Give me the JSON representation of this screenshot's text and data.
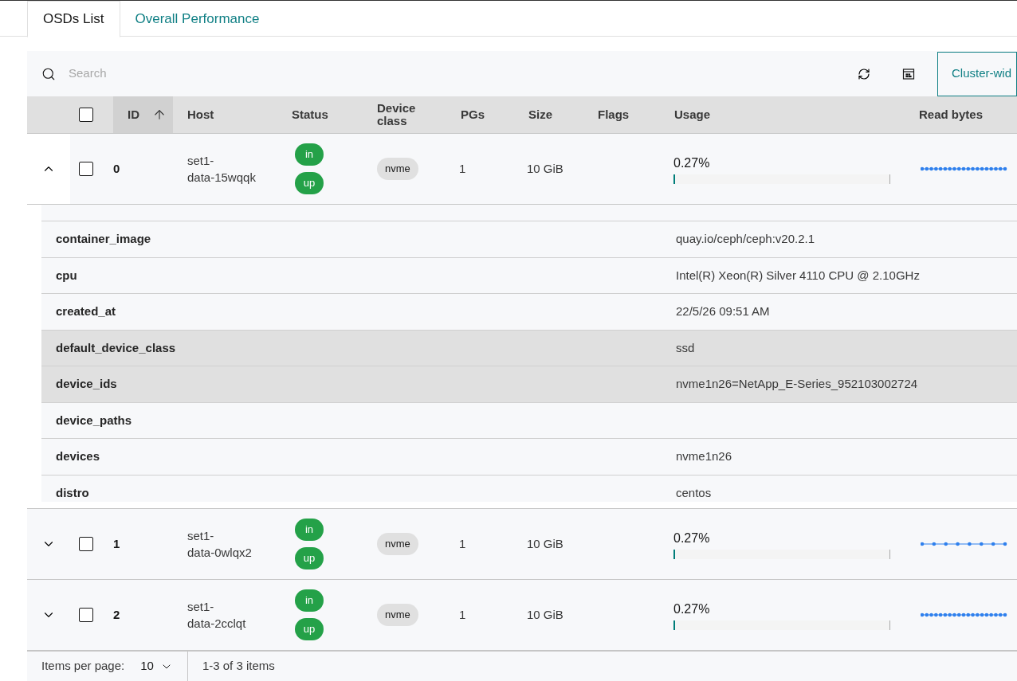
{
  "tabs": [
    {
      "label": "OSDs List",
      "selected": true
    },
    {
      "label": "Overall Performance",
      "selected": false
    }
  ],
  "toolbar": {
    "search": {
      "placeholder": "Search"
    },
    "scope_button": "Cluster-wid"
  },
  "table": {
    "select_all": {
      "checked": false
    },
    "columns": [
      {
        "label": "ID",
        "sorted": true
      },
      {
        "label": "Host",
        "sorted": false
      },
      {
        "label": "Status",
        "sorted": false
      },
      {
        "label": "Device class",
        "sorted": false
      },
      {
        "label": "PGs",
        "sorted": false
      },
      {
        "label": "Size",
        "sorted": false
      },
      {
        "label": "Flags",
        "sorted": false
      },
      {
        "label": "Usage",
        "sorted": false
      },
      {
        "label": "Read bytes",
        "sorted": false
      }
    ],
    "rows": [
      {
        "expanded": true,
        "checked": false,
        "id": "0",
        "host": "set1-\ndata-15wqqk",
        "status": [
          "in",
          "up"
        ],
        "device_class": "nvme",
        "pgs": "1",
        "size": "10 GiB",
        "usage": "0.27%",
        "level": 0.0027,
        "read_bytes": {
          "kind": "dense"
        },
        "details": [
          {
            "key": "container_image",
            "value": "quay.io/ceph/ceph:v20.2.1",
            "highlighted": false
          },
          {
            "key": "cpu",
            "value": "Intel(R) Xeon(R) Silver 4110 CPU @ 2.10GHz",
            "highlighted": false
          },
          {
            "key": "created_at",
            "value": "22/5/26 09:51 AM",
            "highlighted": false
          },
          {
            "key": "default_device_class",
            "value": "ssd",
            "highlighted": true
          },
          {
            "key": "device_ids",
            "value": "nvme1n26=NetApp_E-Series_952103002724",
            "highlighted": true
          },
          {
            "key": "device_paths",
            "highlighted": false
          },
          {
            "key": "devices",
            "value": "nvme1n26",
            "highlighted": false
          },
          {
            "key": "distro",
            "value": "centos",
            "highlighted": false
          }
        ]
      },
      {
        "expanded": false,
        "checked": false,
        "id": "1",
        "host": "set1-\ndata-0wlqx2",
        "status": [
          "in",
          "up"
        ],
        "device_class": "nvme",
        "pgs": "1",
        "size": "10 GiB",
        "usage": "0.27%",
        "level": 0.0027,
        "read_bytes": {
          "kind": "sparse"
        }
      },
      {
        "expanded": false,
        "checked": false,
        "id": "2",
        "host": "set1-\ndata-2cclqt",
        "status": [
          "in",
          "up"
        ],
        "device_class": "nvme",
        "pgs": "1",
        "size": "10 GiB",
        "usage": "0.27%",
        "level": 0.0027,
        "read_bytes": {
          "kind": "dense"
        }
      }
    ]
  },
  "pagination": {
    "items_per_page_label": "Items per page:",
    "items_per_page": "10",
    "range": "1-3 of 3 items"
  }
}
